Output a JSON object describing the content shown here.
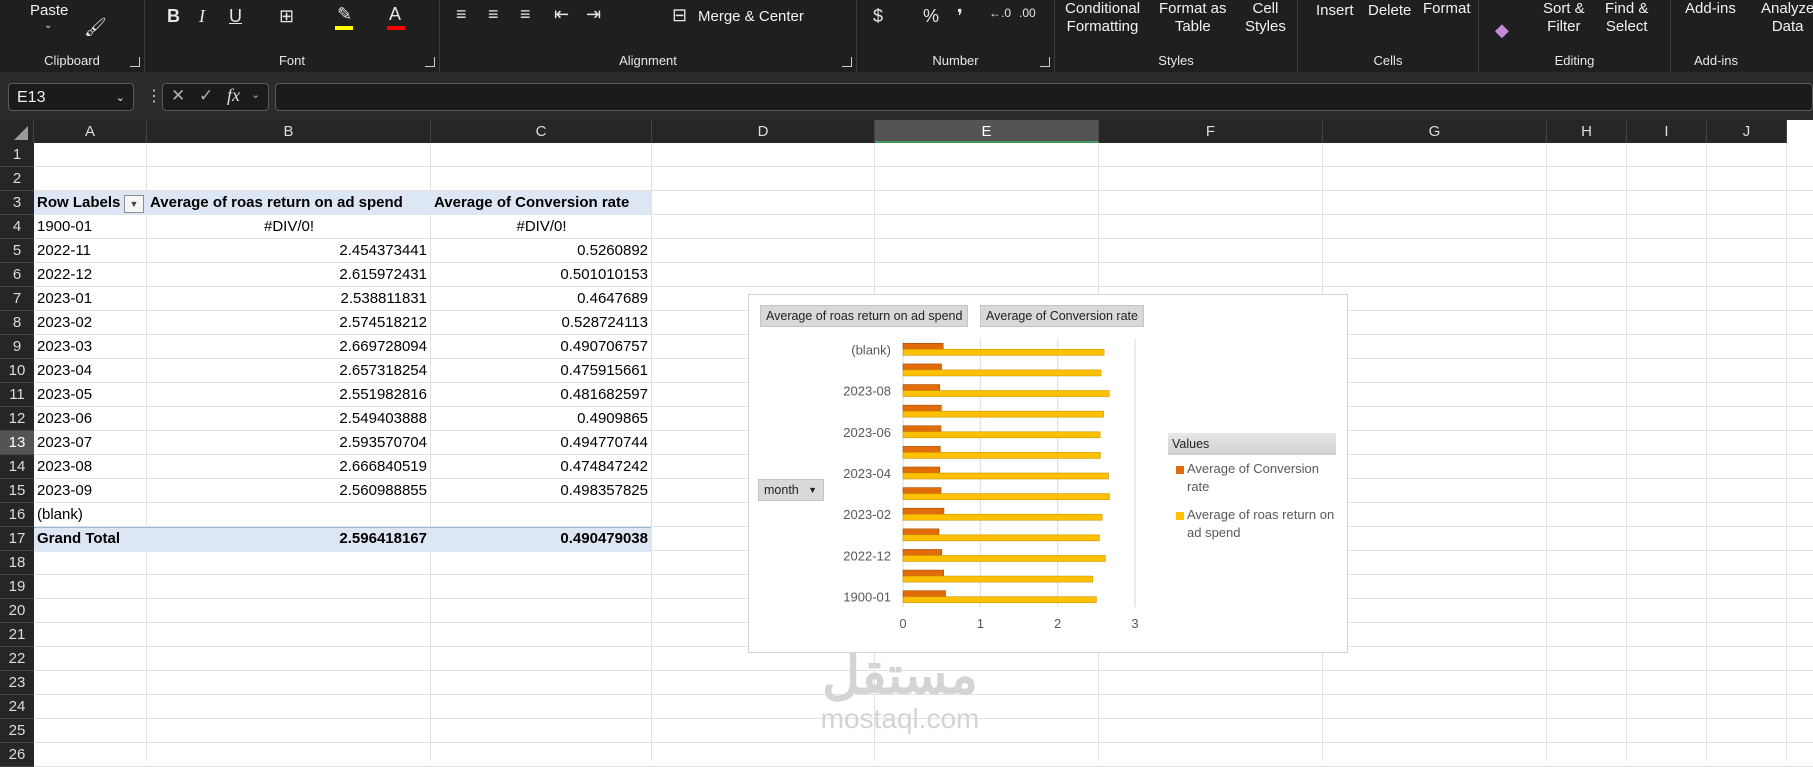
{
  "ribbon": {
    "clipboard": {
      "label": "Clipboard",
      "paste": "Paste"
    },
    "font": {
      "label": "Font"
    },
    "alignment": {
      "label": "Alignment",
      "merge": "Merge & Center"
    },
    "number": {
      "label": "Number"
    },
    "styles": {
      "label": "Styles",
      "conditional": "Conditional\nFormatting",
      "format_table": "Format as\nTable",
      "cell_styles": "Cell\nStyles"
    },
    "cells": {
      "label": "Cells",
      "insert": "Insert",
      "delete": "Delete",
      "format": "Format"
    },
    "editing": {
      "label": "Editing",
      "sort": "Sort &\nFilter",
      "find": "Find &\nSelect"
    },
    "addins": {
      "label": "Add-ins",
      "addins_btn": "Add-ins",
      "analyze": "Analyze\nData"
    }
  },
  "formula_bar": {
    "name_box": "E13",
    "formula": ""
  },
  "columns": [
    "A",
    "B",
    "C",
    "D",
    "E",
    "F",
    "G",
    "H",
    "I",
    "J"
  ],
  "rows": [
    "1",
    "2",
    "3",
    "4",
    "5",
    "6",
    "7",
    "8",
    "9",
    "10",
    "11",
    "12",
    "13",
    "14",
    "15",
    "16",
    "17",
    "18",
    "19",
    "20",
    "21",
    "22",
    "23",
    "24",
    "25",
    "26"
  ],
  "selected": {
    "column": "E",
    "row": "13"
  },
  "pivot": {
    "headers": [
      "Row Labels",
      "Average of roas return on ad spend",
      "Average of Conversion rate"
    ],
    "rows": [
      [
        "1900-01",
        "#DIV/0!",
        "#DIV/0!"
      ],
      [
        "2022-11",
        "2.454373441",
        "0.5260892"
      ],
      [
        "2022-12",
        "2.615972431",
        "0.501010153"
      ],
      [
        "2023-01",
        "2.538811831",
        "0.4647689"
      ],
      [
        "2023-02",
        "2.574518212",
        "0.528724113"
      ],
      [
        "2023-03",
        "2.669728094",
        "0.490706757"
      ],
      [
        "2023-04",
        "2.657318254",
        "0.475915661"
      ],
      [
        "2023-05",
        "2.551982816",
        "0.481682597"
      ],
      [
        "2023-06",
        "2.549403888",
        "0.4909865"
      ],
      [
        "2023-07",
        "2.593570704",
        "0.494770744"
      ],
      [
        "2023-08",
        "2.666840519",
        "0.474847242"
      ],
      [
        "2023-09",
        "2.560988855",
        "0.498357825"
      ],
      [
        "(blank)",
        "",
        ""
      ]
    ],
    "total": [
      "Grand Total",
      "2.596418167",
      "0.490479038"
    ]
  },
  "chart_data": {
    "type": "bar",
    "orientation": "horizontal",
    "categories": [
      "1900-01",
      "2022-11",
      "2022-12",
      "2023-01",
      "2023-02",
      "2023-03",
      "2023-04",
      "2023-05",
      "2023-06",
      "2023-07",
      "2023-08",
      "2023-09",
      "(blank)"
    ],
    "tick_labels": [
      "1900-01",
      "2022-12",
      "2023-02",
      "2023-04",
      "2023-06",
      "2023-08",
      "(blank)"
    ],
    "series": [
      {
        "name": "Average of Conversion rate",
        "color": "#e36c0a",
        "values": [
          0.55,
          0.526,
          0.501,
          0.465,
          0.529,
          0.491,
          0.476,
          0.482,
          0.491,
          0.495,
          0.475,
          0.498,
          0.52
        ]
      },
      {
        "name": "Average of roas return on ad spend",
        "color": "#ffc000",
        "values": [
          2.5,
          2.454,
          2.616,
          2.539,
          2.575,
          2.67,
          2.657,
          2.552,
          2.549,
          2.594,
          2.667,
          2.561,
          2.6
        ]
      }
    ],
    "xlim": [
      0,
      3
    ],
    "x_ticks": [
      "0",
      "1",
      "2",
      "3"
    ],
    "legend_title": "Values",
    "legend_position": "right",
    "field_buttons": [
      "Average of roas return on ad spend",
      "Average of Conversion rate"
    ],
    "axis_field": "month"
  },
  "watermark": {
    "arabic": "مستقل",
    "latin": "mostaql.com"
  }
}
